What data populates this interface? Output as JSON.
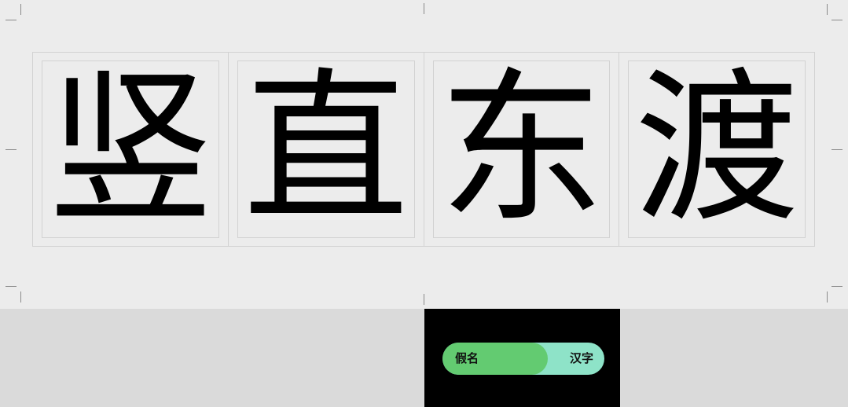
{
  "glyphs": [
    {
      "char": "竖"
    },
    {
      "char": "直"
    },
    {
      "char": "东"
    },
    {
      "char": "渡"
    }
  ],
  "toggle": {
    "left_label": "假名",
    "right_label": "汉字",
    "active": "left",
    "active_color": "#63cb71",
    "track_color": "#8ee3c8"
  }
}
